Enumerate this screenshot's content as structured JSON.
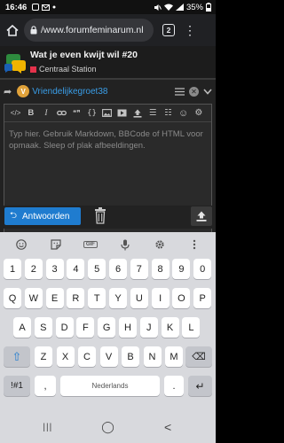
{
  "status_bar": {
    "time": "16:46",
    "battery": "35%"
  },
  "browser": {
    "url": "/www.forumfeminarum.nl",
    "tab_count": "2",
    "menu_glyph": "⋮"
  },
  "topic": {
    "title": "Wat je even kwijt wil #20",
    "category": "Centraal Station",
    "category_color": "#e5324b"
  },
  "composer": {
    "reply_glyph": "➦",
    "avatar_letter": "V",
    "username": "Vriendelijkegroet38",
    "placeholder": "Typ hier. Gebruik Markdown, BBCode of HTML voor opmaak. Sleep of plak afbeeldingen.",
    "toolbar": [
      "</>",
      "B",
      "I",
      "link-icon",
      "quote-icon",
      "code-icon",
      "image-icon",
      "video-icon",
      "upload-icon",
      "bullet-list-icon",
      "numbered-list-icon",
      "emoji-icon",
      "gear-icon"
    ],
    "toolbar_glyphs": {
      "code_tag": "</>",
      "bold": "B",
      "italic": "I",
      "quote": "❝❞",
      "code": "{}",
      "bullet": "☰",
      "numbered": "☷",
      "emoji": "☺",
      "gear": "⚙"
    },
    "submit_label": "Antwoorden",
    "submit_arrow": "⮌",
    "accent_color": "#1f7ccf"
  },
  "keyboard": {
    "top_icons": [
      "emoji-icon",
      "sticker-icon",
      "gif-icon",
      "microphone-icon",
      "gear-icon",
      "more-icon"
    ],
    "gif_label": "GIF",
    "row_numbers": [
      "1",
      "2",
      "3",
      "4",
      "5",
      "6",
      "7",
      "8",
      "9",
      "0"
    ],
    "row_top": [
      "Q",
      "W",
      "E",
      "R",
      "T",
      "Y",
      "U",
      "I",
      "O",
      "P"
    ],
    "row_mid": [
      "A",
      "S",
      "D",
      "F",
      "G",
      "H",
      "J",
      "K",
      "L"
    ],
    "row_bottom": [
      "Z",
      "X",
      "C",
      "V",
      "B",
      "N",
      "M"
    ],
    "symbols_label": "!#1",
    "comma": ",",
    "space_label": "Nederlands",
    "period": ".",
    "shift_glyph": "⇧",
    "backspace_glyph": "⌫",
    "enter_glyph": "↵"
  },
  "nav": {
    "recents_glyph": "|||",
    "home_glyph": "◯",
    "back_glyph": "<"
  }
}
